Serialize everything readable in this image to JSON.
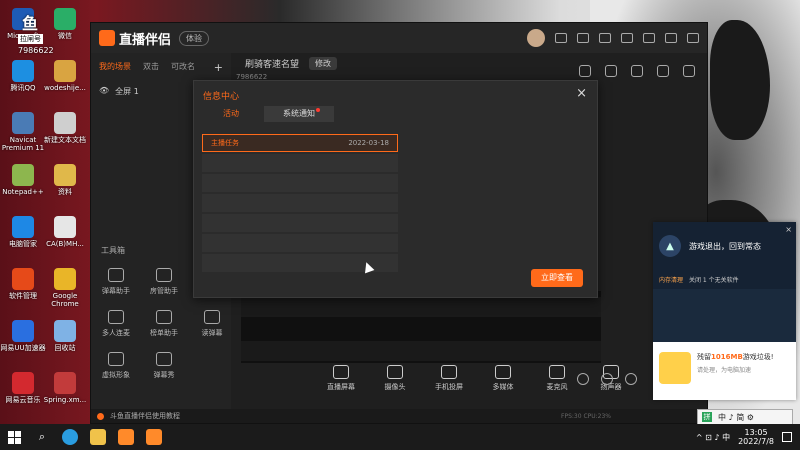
{
  "desktop": {
    "icons_left": [
      {
        "label": "Microsoft",
        "color": "#1e5bb5"
      },
      {
        "label": "微信",
        "color": "#2aae67"
      },
      {
        "label": "腾讯QQ",
        "color": "#1d8fe1"
      },
      {
        "label": "wodeshije...",
        "color": "#d9a441"
      },
      {
        "label": "Navicat Premium 11",
        "color": "#4a7bb5"
      },
      {
        "label": "新建文本文档",
        "color": "#cfcfcf"
      },
      {
        "label": "Notepad++",
        "color": "#8db64e"
      },
      {
        "label": "资料",
        "color": "#e0b84a"
      },
      {
        "label": "电脑管家",
        "color": "#1e88e5"
      },
      {
        "label": "CA(B)MH...",
        "color": "#e6e6e6"
      },
      {
        "label": "软件管理",
        "color": "#e64a19"
      },
      {
        "label": "Google Chrome",
        "color": "#e9b528"
      },
      {
        "label": "网易UU加速器",
        "color": "#2a6fe0"
      },
      {
        "label": "回收站",
        "color": "#7fb2e5"
      },
      {
        "label": "网易云音乐",
        "color": "#d3292f"
      },
      {
        "label": "Spring.xm...",
        "color": "#c23b3b"
      }
    ],
    "top_overlay_text_1": "鱼",
    "top_overlay_text_2": "拉闸号",
    "top_overlay_text_3": "7986622"
  },
  "app": {
    "brand": "直播伴侣",
    "badge": "体验",
    "sidebar_tabs": [
      "我的场景",
      "双击",
      "可改名"
    ],
    "scene_label": "全屏 1",
    "tools_title": "工具箱",
    "tools": [
      {
        "label": "弹幕助手"
      },
      {
        "label": "房管助手"
      },
      {
        "label": "视频连麦"
      },
      {
        "label": "多人连麦"
      },
      {
        "label": "榜单助手"
      },
      {
        "label": "读弹幕"
      },
      {
        "label": "虚拟形象"
      },
      {
        "label": "弹幕秀"
      }
    ],
    "main_title": "刷骑客速名望",
    "main_edit": "修改",
    "main_sub": "7986622",
    "bottom_actions": [
      {
        "label": "直播屏幕"
      },
      {
        "label": "摄像头"
      },
      {
        "label": "手机投屏"
      },
      {
        "label": "多媒体"
      },
      {
        "label": "麦克风"
      },
      {
        "label": "扬声器"
      }
    ],
    "status_text": "斗鱼直播伴侣使用教程",
    "status_right": "FPS:30  CPU:23%"
  },
  "modal": {
    "title": "信息中心",
    "close": "×",
    "tab_active": "活动",
    "tab_inactive": "系统通知",
    "rows": [
      {
        "title": "主播任务",
        "date": "2022-03-18",
        "selected": true
      },
      {
        "title": "",
        "date": "",
        "selected": false
      },
      {
        "title": "",
        "date": "",
        "selected": false
      },
      {
        "title": "",
        "date": "",
        "selected": false
      },
      {
        "title": "",
        "date": "",
        "selected": false
      },
      {
        "title": "",
        "date": "",
        "selected": false
      },
      {
        "title": "",
        "date": "",
        "selected": false
      }
    ],
    "view_button": "立即查看"
  },
  "notification": {
    "message": "游戏退出，回到常态",
    "line_key": "内存清理",
    "line_text": "关闭 1 个无关软件",
    "foot_line1_a": "残留",
    "foot_line1_b": "1016MB",
    "foot_line1_c": "游戏垃圾!",
    "foot_line2": "请处理，为电脑加速",
    "close": "×"
  },
  "ime": {
    "g": "拼",
    "text": "中 ♪ 简 ⚙"
  },
  "taskbar": {
    "time": "13:05",
    "date": "2022/7/8",
    "tray": "^ ⊡ ♪ 中"
  }
}
